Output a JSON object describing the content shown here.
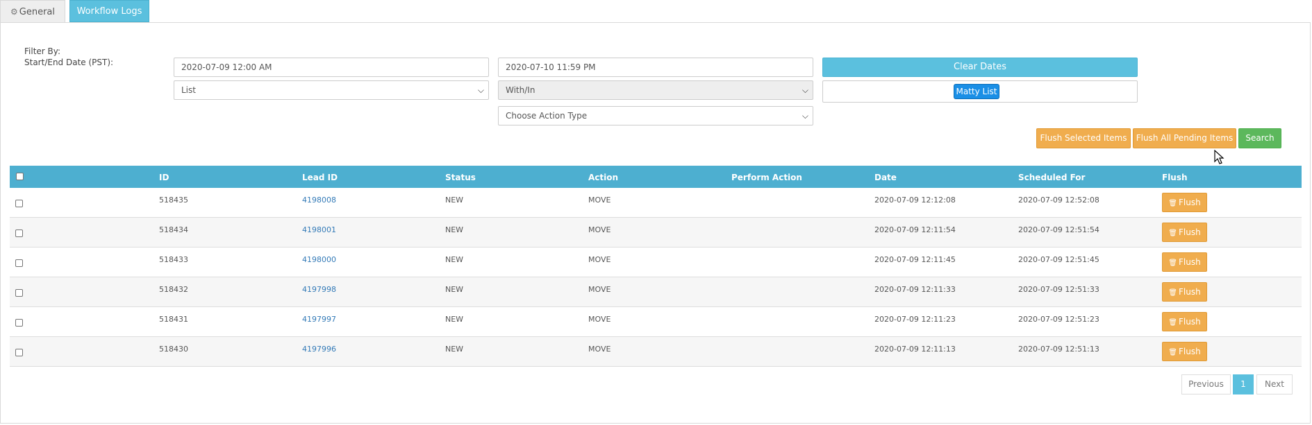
{
  "tabs": [
    {
      "label": "General"
    },
    {
      "label": "Workflow Logs"
    }
  ],
  "filters": {
    "filter_by_label": "Filter By:",
    "date_label": "Start/End Date (PST):",
    "start_date": "2020-07-09 12:00 AM",
    "end_date": "2020-07-10 11:59 PM",
    "clear_dates_label": "Clear Dates",
    "type_select": "List",
    "condition_select": "With/In",
    "selected_tag": "Matty List",
    "action_type_select": "Choose Action Type"
  },
  "actions": {
    "flush_selected": "Flush Selected Items",
    "flush_all_pending": "Flush All Pending Items",
    "search": "Search"
  },
  "table": {
    "headers": [
      "ID",
      "Lead ID",
      "Status",
      "Action",
      "Perform Action",
      "Date",
      "Scheduled For",
      "Flush"
    ],
    "flush_button_label": "Flush",
    "rows": [
      {
        "id": "518435",
        "lead_id": "4198008",
        "status": "NEW",
        "action": "MOVE",
        "perform_action": "",
        "date": "2020-07-09 12:12:08",
        "scheduled_for": "2020-07-09 12:52:08"
      },
      {
        "id": "518434",
        "lead_id": "4198001",
        "status": "NEW",
        "action": "MOVE",
        "perform_action": "",
        "date": "2020-07-09 12:11:54",
        "scheduled_for": "2020-07-09 12:51:54"
      },
      {
        "id": "518433",
        "lead_id": "4198000",
        "status": "NEW",
        "action": "MOVE",
        "perform_action": "",
        "date": "2020-07-09 12:11:45",
        "scheduled_for": "2020-07-09 12:51:45"
      },
      {
        "id": "518432",
        "lead_id": "4197998",
        "status": "NEW",
        "action": "MOVE",
        "perform_action": "",
        "date": "2020-07-09 12:11:33",
        "scheduled_for": "2020-07-09 12:51:33"
      },
      {
        "id": "518431",
        "lead_id": "4197997",
        "status": "NEW",
        "action": "MOVE",
        "perform_action": "",
        "date": "2020-07-09 12:11:23",
        "scheduled_for": "2020-07-09 12:51:23"
      },
      {
        "id": "518430",
        "lead_id": "4197996",
        "status": "NEW",
        "action": "MOVE",
        "perform_action": "",
        "date": "2020-07-09 12:11:13",
        "scheduled_for": "2020-07-09 12:51:13"
      }
    ]
  },
  "pagination": {
    "previous": "Previous",
    "current_page": "1",
    "next": "Next"
  },
  "colors": {
    "info": "#5bc0de",
    "warning": "#f0ad4e",
    "success": "#5cb85c",
    "tag": "#1a8fe6",
    "table_header": "#4dafd0"
  }
}
